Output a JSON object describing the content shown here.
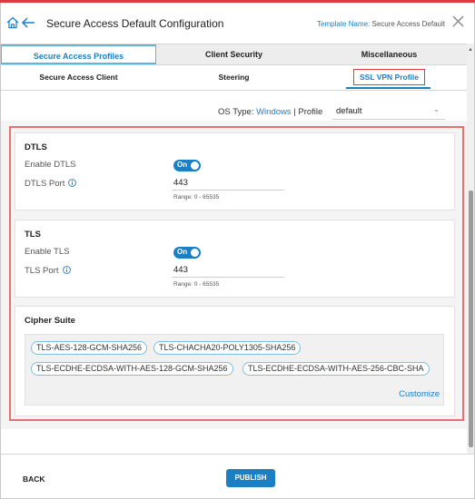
{
  "header": {
    "title": "Secure Access Default Configuration",
    "template_key": "Template Name:",
    "template_value": "Secure Access Default"
  },
  "tabs_primary": [
    {
      "label": "Secure Access Profiles",
      "active": true
    },
    {
      "label": "Client Security",
      "active": false
    },
    {
      "label": "Miscellaneous",
      "active": false
    }
  ],
  "tabs_secondary": [
    {
      "label": "Secure Access Client",
      "active": false
    },
    {
      "label": "Steering",
      "active": false
    },
    {
      "label": "SSL VPN Profile",
      "active": true
    }
  ],
  "filters": {
    "os_type_label": "OS Type:",
    "os_type_value": "Windows",
    "separator": "|",
    "profile_label": "Profile",
    "profile_value": "default"
  },
  "dtls": {
    "title": "DTLS",
    "enable_label": "Enable DTLS",
    "enable_state": "On",
    "port_label": "DTLS Port",
    "port_value": "443",
    "range": "Range: 0 - 65535"
  },
  "tls": {
    "title": "TLS",
    "enable_label": "Enable TLS",
    "enable_state": "On",
    "port_label": "TLS Port",
    "port_value": "443",
    "range": "Range: 0 - 65535"
  },
  "cipher": {
    "title": "Cipher Suite",
    "suites": [
      "TLS-AES-128-GCM-SHA256",
      "TLS-CHACHA20-POLY1305-SHA256",
      "TLS-ECDHE-ECDSA-WITH-AES-128-GCM-SHA256",
      "TLS-ECDHE-ECDSA-WITH-AES-256-CBC-SHA"
    ],
    "customize_label": "Customize"
  },
  "footer": {
    "back_label": "BACK",
    "publish_label": "PUBLISH"
  },
  "colors": {
    "accent": "#1b7fc4",
    "highlight": "#e03a3a"
  }
}
